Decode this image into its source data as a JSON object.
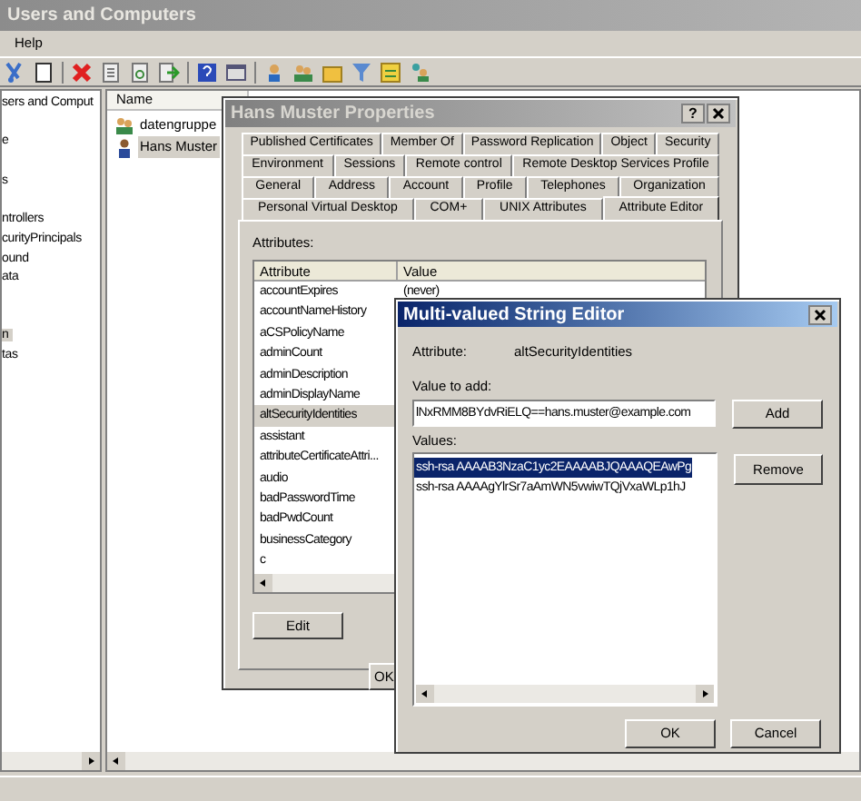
{
  "window": {
    "title": "Users and Computers"
  },
  "menu": [
    {
      "label": "Help"
    }
  ],
  "tree": {
    "items": [
      {
        "label": "sers and Comput",
        "selected": false
      },
      {
        "label": "e",
        "selected": false
      },
      {
        "label": "s",
        "selected": false
      },
      {
        "label": "ntrollers",
        "selected": false
      },
      {
        "label": "curityPrincipals",
        "selected": false
      },
      {
        "label": "ound",
        "selected": false
      },
      {
        "label": "ata",
        "selected": false
      },
      {
        "label": "n",
        "selected": true
      },
      {
        "label": "tas",
        "selected": false
      }
    ]
  },
  "list": {
    "column": "Name",
    "items": [
      {
        "label": "datengruppe",
        "kind": "group",
        "selected": false
      },
      {
        "label": "Hans Muster",
        "kind": "user",
        "selected": true
      }
    ]
  },
  "properties": {
    "title": "Hans Muster Properties",
    "help_button": "?",
    "tab_rows": [
      [
        {
          "label": "Published Certificates",
          "selected": false
        },
        {
          "label": "Member Of",
          "selected": false
        },
        {
          "label": "Password Replication",
          "selected": false
        },
        {
          "label": "Object",
          "selected": false
        },
        {
          "label": "Security",
          "selected": false
        }
      ],
      [
        {
          "label": "Environment",
          "selected": false
        },
        {
          "label": "Sessions",
          "selected": false
        },
        {
          "label": "Remote control",
          "selected": false
        },
        {
          "label": "Remote Desktop Services Profile",
          "selected": false
        }
      ],
      [
        {
          "label": "General",
          "selected": false
        },
        {
          "label": "Address",
          "selected": false
        },
        {
          "label": "Account",
          "selected": false
        },
        {
          "label": "Profile",
          "selected": false
        },
        {
          "label": "Telephones",
          "selected": false
        },
        {
          "label": "Organization",
          "selected": false
        }
      ],
      [
        {
          "label": "Personal Virtual Desktop",
          "selected": false
        },
        {
          "label": "COM+",
          "selected": false
        },
        {
          "label": "UNIX Attributes",
          "selected": false
        },
        {
          "label": "Attribute Editor",
          "selected": true
        }
      ]
    ],
    "attributes_label": "Attributes:",
    "columns": [
      "Attribute",
      "Value"
    ],
    "rows": [
      {
        "attribute": "accountExpires",
        "value": "(never)",
        "selected": false
      },
      {
        "attribute": "accountNameHistory",
        "selected": false
      },
      {
        "attribute": "aCSPolicyName",
        "selected": false
      },
      {
        "attribute": "adminCount",
        "selected": false
      },
      {
        "attribute": "adminDescription",
        "selected": false
      },
      {
        "attribute": "adminDisplayName",
        "selected": false
      },
      {
        "attribute": "altSecurityIdentities",
        "selected": true
      },
      {
        "attribute": "assistant",
        "selected": false
      },
      {
        "attribute": "attributeCertificateAttri...",
        "selected": false
      },
      {
        "attribute": "audio",
        "selected": false
      },
      {
        "attribute": "badPasswordTime",
        "selected": false
      },
      {
        "attribute": "badPwdCount",
        "selected": false
      },
      {
        "attribute": "businessCategory",
        "selected": false
      },
      {
        "attribute": "c",
        "selected": false
      }
    ],
    "edit_button": "Edit",
    "ok_button": "OK"
  },
  "editor": {
    "title": "Multi-valued String Editor",
    "attribute_label": "Attribute:",
    "attribute_value": "altSecurityIdentities",
    "value_to_add_label": "Value to add:",
    "value_to_add": "lNxRMM8BYdvRiELQ==hans.muster@example.com",
    "add_button": "Add",
    "values_label": "Values:",
    "values": [
      {
        "text": "ssh-rsa AAAAB3NzaC1yc2EAAAABJQAAAQEAwPg",
        "selected": true
      },
      {
        "text": "ssh-rsa AAAAgYlrSr7aAmWN5vwiwTQjVxaWLp1hJ",
        "selected": false
      }
    ],
    "remove_button": "Remove",
    "ok_button": "OK",
    "cancel_button": "Cancel"
  }
}
